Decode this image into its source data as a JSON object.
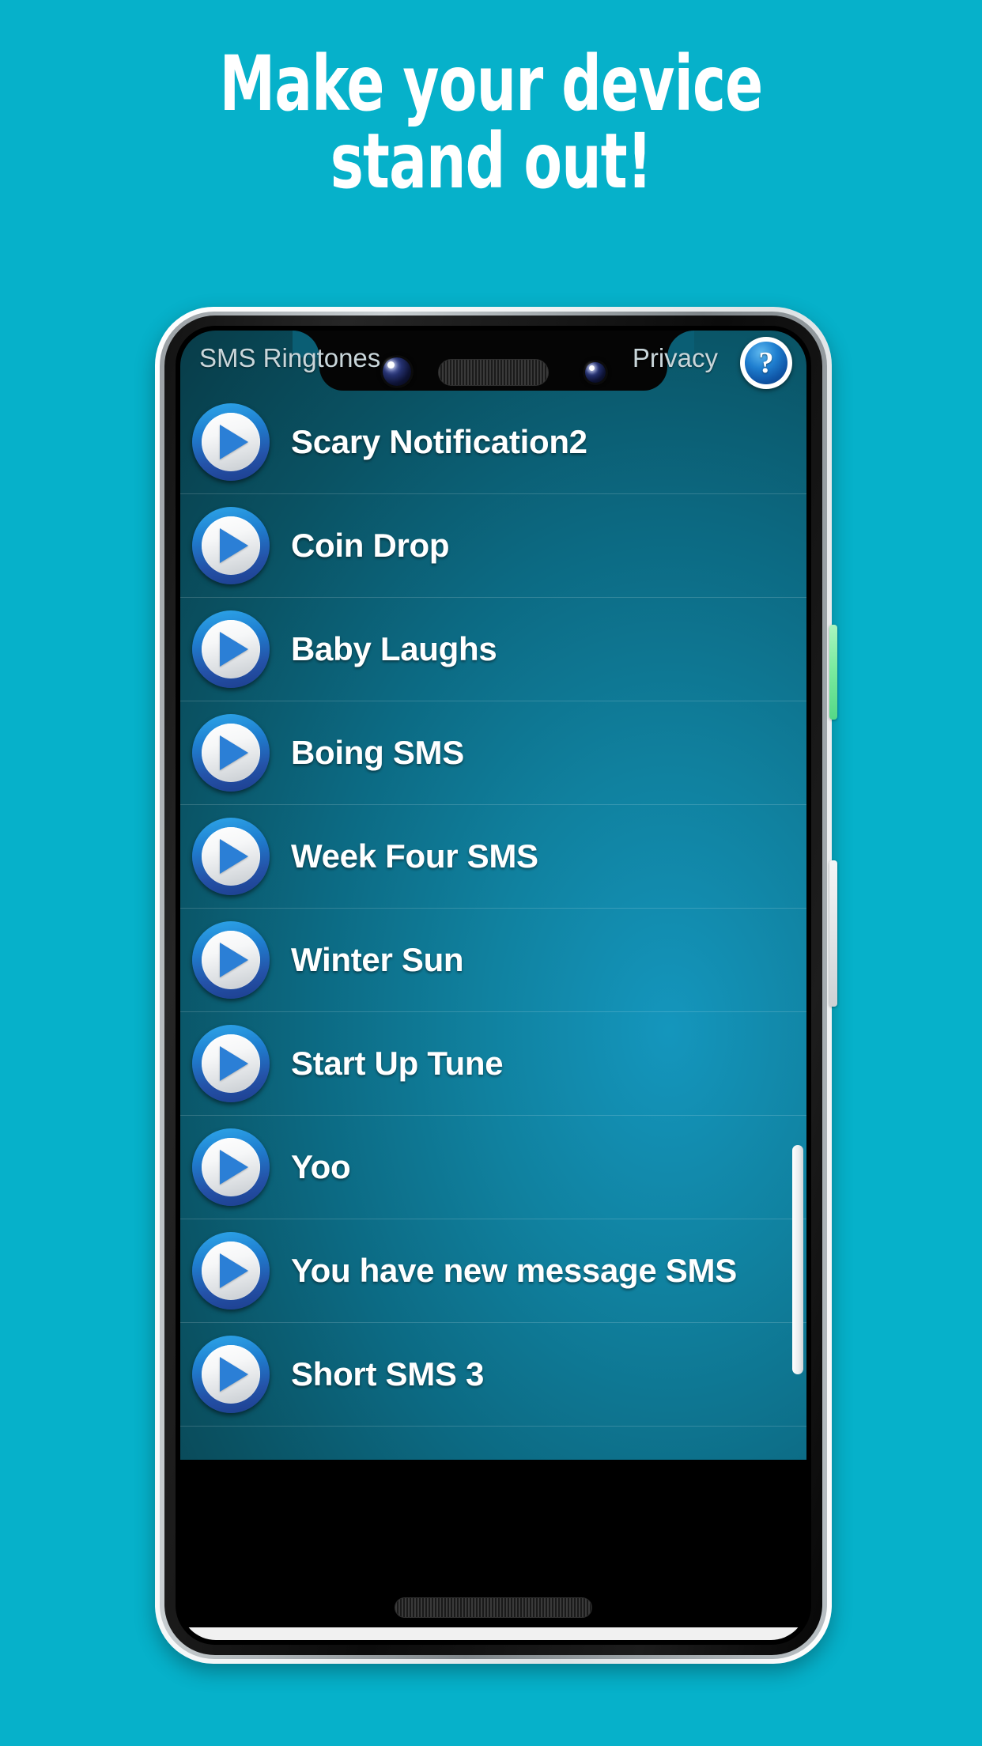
{
  "page": {
    "background_color": "#06b1ca"
  },
  "headline": {
    "line1": "Make your device",
    "line2": "stand out!",
    "color": "#ffffff"
  },
  "phone": {
    "frame_color": "#ffffff",
    "body_color": "#131313",
    "side_buttons": {
      "volume_color": "#7ceba0",
      "power_color": "#e2e5e7"
    },
    "hardware": {
      "earpiece": "speaker-grille",
      "camera_main": "front-camera",
      "camera_secondary": "front-camera-secondary",
      "bottom_speaker": "speaker-grille"
    }
  },
  "app": {
    "topbar": {
      "title": "SMS Ringtones",
      "privacy_label": "Privacy",
      "help_icon_glyph": "?",
      "help_icon_color": "#1f7fd0",
      "text_color": "#c9d6da"
    },
    "accent_color": "#1f7fd0",
    "list_background_color": "#0c6a83",
    "ringtones": [
      {
        "name": "Scary Notification2",
        "icon": "play-icon"
      },
      {
        "name": "Coin Drop",
        "icon": "play-icon"
      },
      {
        "name": "Baby Laughs",
        "icon": "play-icon"
      },
      {
        "name": "Boing SMS",
        "icon": "play-icon"
      },
      {
        "name": "Week Four SMS",
        "icon": "play-icon"
      },
      {
        "name": "Winter Sun",
        "icon": "play-icon"
      },
      {
        "name": "Start Up Tune",
        "icon": "play-icon"
      },
      {
        "name": "Yoo",
        "icon": "play-icon"
      },
      {
        "name": "You have new message SMS",
        "icon": "play-icon"
      },
      {
        "name": "Short SMS 3",
        "icon": "play-icon"
      }
    ]
  },
  "navbar": {
    "recents_label": "recents-icon",
    "home_label": "home-icon",
    "back_label": "back-icon",
    "background_color": "#f1f1f1",
    "icon_color": "#8c8c8c"
  }
}
